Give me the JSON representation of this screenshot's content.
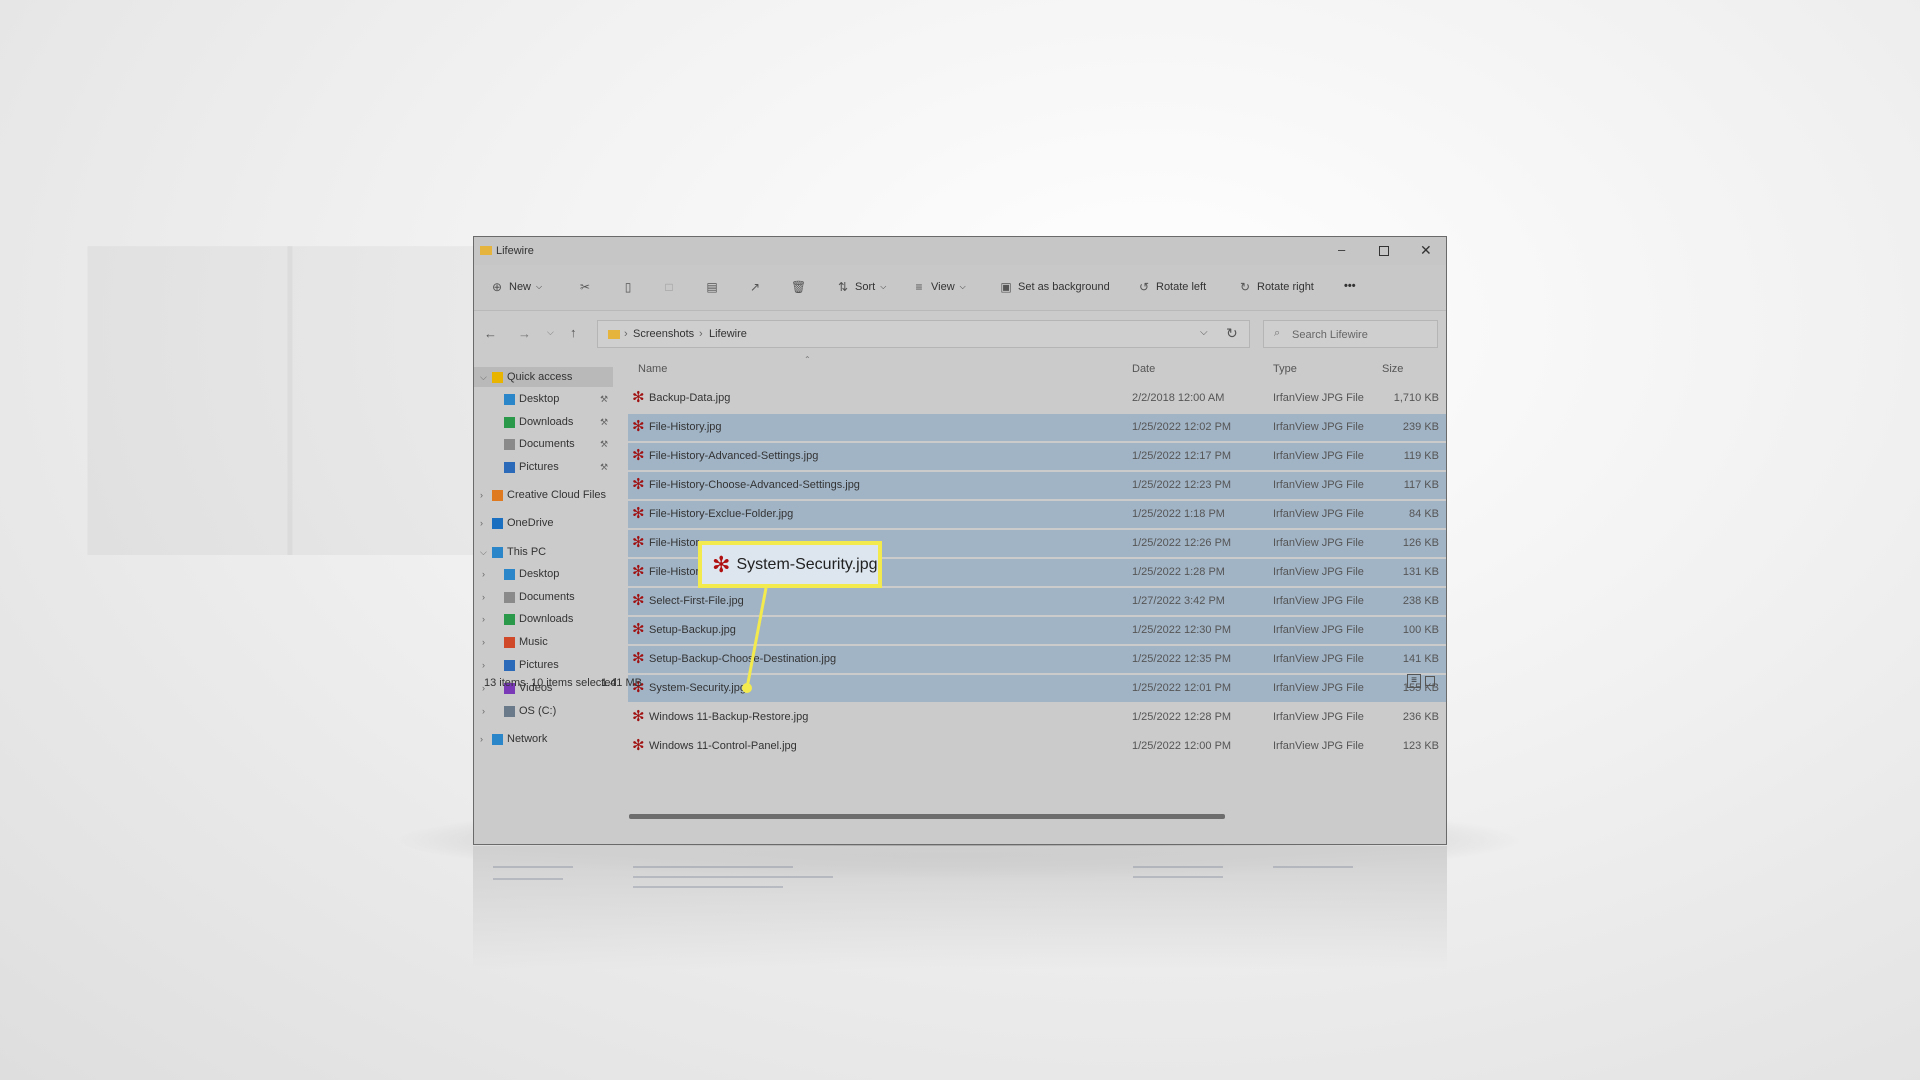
{
  "window": {
    "title": "Lifewire",
    "minimize_icon": "minimize-icon",
    "maximize_icon": "maximize-icon",
    "close_icon": "close-icon"
  },
  "toolbar": {
    "new_label": "New",
    "sort_label": "Sort",
    "view_label": "View",
    "set_bg_label": "Set as background",
    "rotate_left_label": "Rotate left",
    "rotate_right_label": "Rotate right",
    "more_label": "•••"
  },
  "address": {
    "crumbs": [
      "Screenshots",
      "Lifewire"
    ],
    "search_placeholder": "Search Lifewire"
  },
  "columns": {
    "name": "Name",
    "date": "Date",
    "type": "Type",
    "size": "Size"
  },
  "sidebar": [
    {
      "label": "Quick access",
      "level": 0,
      "expanded": true,
      "selected": true,
      "color": "#e8b400"
    },
    {
      "label": "Desktop",
      "level": 1,
      "pinned": true,
      "color": "#2a86c8"
    },
    {
      "label": "Downloads",
      "level": 1,
      "pinned": true,
      "color": "#2a9a4a"
    },
    {
      "label": "Documents",
      "level": 1,
      "pinned": true,
      "color": "#8a8a8a"
    },
    {
      "label": "Pictures",
      "level": 1,
      "pinned": true,
      "color": "#2a6ab8"
    },
    {
      "label": "Creative Cloud Files",
      "level": 0,
      "expanded": false,
      "color": "#e07a20"
    },
    {
      "label": "OneDrive",
      "level": 0,
      "expanded": false,
      "color": "#1a6fc0"
    },
    {
      "label": "This PC",
      "level": 0,
      "expanded": true,
      "color": "#2a86c8"
    },
    {
      "label": "Desktop",
      "level": 1,
      "expanded": false,
      "color": "#2a86c8"
    },
    {
      "label": "Documents",
      "level": 1,
      "expanded": false,
      "color": "#8a8a8a"
    },
    {
      "label": "Downloads",
      "level": 1,
      "expanded": false,
      "color": "#2a9a4a"
    },
    {
      "label": "Music",
      "level": 1,
      "expanded": false,
      "color": "#d04a2a"
    },
    {
      "label": "Pictures",
      "level": 1,
      "expanded": false,
      "color": "#2a6ab8"
    },
    {
      "label": "Videos",
      "level": 1,
      "expanded": false,
      "color": "#7a3ab8"
    },
    {
      "label": "OS (C:)",
      "level": 1,
      "expanded": false,
      "color": "#6a7a8a"
    },
    {
      "label": "Network",
      "level": 0,
      "expanded": false,
      "color": "#2a86c8"
    }
  ],
  "files": [
    {
      "name": "Backup-Data.jpg",
      "date": "2/2/2018 12:00 AM",
      "type": "IrfanView JPG File",
      "size": "1,710 KB",
      "selected": false
    },
    {
      "name": "File-History.jpg",
      "date": "1/25/2022 12:02 PM",
      "type": "IrfanView JPG File",
      "size": "239 KB",
      "selected": true
    },
    {
      "name": "File-History-Advanced-Settings.jpg",
      "date": "1/25/2022 12:17 PM",
      "type": "IrfanView JPG File",
      "size": "119 KB",
      "selected": true
    },
    {
      "name": "File-History-Choose-Advanced-Settings.jpg",
      "date": "1/25/2022 12:23 PM",
      "type": "IrfanView JPG File",
      "size": "117 KB",
      "selected": true
    },
    {
      "name": "File-History-Exclue-Folder.jpg",
      "date": "1/25/2022 1:18 PM",
      "type": "IrfanView JPG File",
      "size": "84 KB",
      "selected": true
    },
    {
      "name": "File-Histor",
      "date": "1/25/2022 12:26 PM",
      "type": "IrfanView JPG File",
      "size": "126 KB",
      "selected": true
    },
    {
      "name": "File-Histor",
      "date": "1/25/2022 1:28 PM",
      "type": "IrfanView JPG File",
      "size": "131 KB",
      "selected": true
    },
    {
      "name": "Select-First-File.jpg",
      "date": "1/27/2022 3:42 PM",
      "type": "IrfanView JPG File",
      "size": "238 KB",
      "selected": true
    },
    {
      "name": "Setup-Backup.jpg",
      "date": "1/25/2022 12:30 PM",
      "type": "IrfanView JPG File",
      "size": "100 KB",
      "selected": true
    },
    {
      "name": "Setup-Backup-Choose-Destination.jpg",
      "date": "1/25/2022 12:35 PM",
      "type": "IrfanView JPG File",
      "size": "141 KB",
      "selected": true
    },
    {
      "name": "System-Security.jpg",
      "date": "1/25/2022 12:01 PM",
      "type": "IrfanView JPG File",
      "size": "155 KB",
      "selected": true
    },
    {
      "name": "Windows 11-Backup-Restore.jpg",
      "date": "1/25/2022 12:28 PM",
      "type": "IrfanView JPG File",
      "size": "236 KB",
      "selected": false
    },
    {
      "name": "Windows 11-Control-Panel.jpg",
      "date": "1/25/2022 12:00 PM",
      "type": "IrfanView JPG File",
      "size": "123 KB",
      "selected": false
    }
  ],
  "status": {
    "items": "13 items",
    "selected": "10 items selected",
    "size": "1.41 MB"
  },
  "callout": {
    "label": "System-Security.jpg",
    "color": "#f3ea4e"
  },
  "colors": {
    "selection": "#a1b4c6",
    "file_icon": "#a01010"
  }
}
